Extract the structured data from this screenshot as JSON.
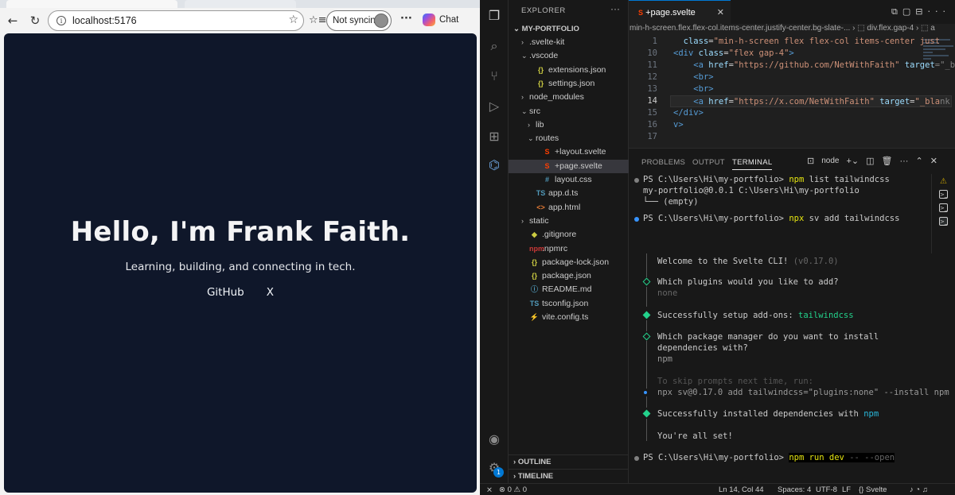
{
  "browser": {
    "address": "localhost:5176",
    "sync_label": "Not syncing",
    "chat_label": "Chat",
    "hero_title": "Hello, I'm Frank Faith.",
    "hero_subtitle": "Learning, building, and connecting in tech.",
    "link_github": "GitHub",
    "link_x": "X"
  },
  "vscode": {
    "explorer_title": "EXPLORER",
    "project": "MY-PORTFOLIO",
    "tree": [
      {
        "label": ".svelte-kit",
        "chev": "›",
        "icon": "",
        "depth": 0
      },
      {
        "label": ".vscode",
        "chev": "⌄",
        "icon": "",
        "depth": 0
      },
      {
        "label": "extensions.json",
        "chev": "",
        "icon": "{}",
        "depth": 1
      },
      {
        "label": "settings.json",
        "chev": "",
        "icon": "{}",
        "depth": 1
      },
      {
        "label": "node_modules",
        "chev": "›",
        "icon": "",
        "depth": 0
      },
      {
        "label": "src",
        "chev": "⌄",
        "icon": "",
        "depth": 0
      },
      {
        "label": "lib",
        "chev": "›",
        "icon": "",
        "depth": 1
      },
      {
        "label": "routes",
        "chev": "⌄",
        "icon": "",
        "depth": 1
      },
      {
        "label": "+layout.svelte",
        "chev": "",
        "icon": "S",
        "depth": 2
      },
      {
        "label": "+page.svelte",
        "chev": "",
        "icon": "S",
        "depth": 2
      },
      {
        "label": "layout.css",
        "chev": "",
        "icon": "#",
        "depth": 2
      },
      {
        "label": "app.d.ts",
        "chev": "",
        "icon": "TS",
        "depth": 1
      },
      {
        "label": "app.html",
        "chev": "",
        "icon": "<>",
        "depth": 1
      },
      {
        "label": "static",
        "chev": "›",
        "icon": "",
        "depth": 0
      },
      {
        "label": ".gitignore",
        "chev": "",
        "icon": "◆",
        "depth": 0
      },
      {
        "label": ".npmrc",
        "chev": "",
        "icon": "npm",
        "depth": 0
      },
      {
        "label": "package-lock.json",
        "chev": "",
        "icon": "{}",
        "depth": 0
      },
      {
        "label": "package.json",
        "chev": "",
        "icon": "{}",
        "depth": 0
      },
      {
        "label": "README.md",
        "chev": "",
        "icon": "ⓘ",
        "depth": 0
      },
      {
        "label": "tsconfig.json",
        "chev": "",
        "icon": "TS",
        "depth": 0
      },
      {
        "label": "vite.config.ts",
        "chev": "",
        "icon": "⚡",
        "depth": 0
      }
    ],
    "outline_label": "OUTLINE",
    "timeline_label": "TIMELINE",
    "settings_badge": "1",
    "editor_tab": "+page.svelte",
    "breadcrumb": "min-h-screen.flex.flex-col.items-center.justify-center.bg-slate-...  ›  ⬚ div.flex.gap-4  ›  ⬚ a",
    "code_lines": [
      {
        "num": "1",
        "parts": [
          [
            "",
            "  "
          ],
          [
            "at",
            "class"
          ],
          [
            "",
            "="
          ],
          [
            "st",
            "\"min-h-screen flex flex-col items-center just"
          ]
        ]
      },
      {
        "num": "10",
        "parts": [
          [
            "tg",
            "<div"
          ],
          [
            "at",
            " class"
          ],
          [
            "",
            "="
          ],
          [
            "st",
            "\"flex gap-4\""
          ],
          [
            "tg",
            ">"
          ]
        ]
      },
      {
        "num": "11",
        "parts": [
          [
            "",
            "    "
          ],
          [
            "tg",
            "<a"
          ],
          [
            "at",
            " href"
          ],
          [
            "",
            "="
          ],
          [
            "st",
            "\"https://github.com/NetWithFaith\""
          ],
          [
            "at",
            " target"
          ],
          [
            "gr",
            "=\"_bla"
          ]
        ]
      },
      {
        "num": "12",
        "parts": [
          [
            "",
            "    "
          ],
          [
            "tg",
            "<br>"
          ]
        ]
      },
      {
        "num": "13",
        "parts": [
          [
            "",
            "    "
          ],
          [
            "tg",
            "<br>"
          ]
        ]
      },
      {
        "num": "14",
        "parts": [
          [
            "",
            "    "
          ],
          [
            "tg",
            "<a"
          ],
          [
            "at",
            " href"
          ],
          [
            "",
            "="
          ],
          [
            "st",
            "\"https://x.com/NetWithFaith\""
          ],
          [
            "at",
            " target"
          ],
          [
            "",
            "="
          ],
          [
            "st",
            "\"_bla"
          ],
          [
            "gr",
            "nk\">X"
          ]
        ]
      },
      {
        "num": "15",
        "parts": [
          [
            "tg",
            "</div>"
          ]
        ]
      },
      {
        "num": "16",
        "parts": [
          [
            "tg",
            "v>"
          ]
        ]
      },
      {
        "num": "17",
        "parts": [
          [
            "",
            ""
          ]
        ]
      }
    ],
    "panel_tabs": [
      "PROBLEMS",
      "OUTPUT",
      "TERMINAL"
    ],
    "terminal_shell": "node",
    "terminal": {
      "l1_prompt": "PS C:\\Users\\Hi\\my-portfolio> ",
      "l1_cmd": "npm",
      "l1_rest": " list tailwindcss",
      "l2": "my-portfolio@0.0.1 C:\\Users\\Hi\\my-portfolio",
      "l3": "└── (empty)",
      "l4_prompt": "PS C:\\Users\\Hi\\my-portfolio> ",
      "l4_cmd": "npx",
      "l4_rest": " sv add tailwindcss",
      "welcome": "Welcome to the Svelte CLI! ",
      "welcome_ver": "(v0.17.0)",
      "q_plugins": "Which plugins would you like to add?",
      "a_plugins": "none",
      "ok_addons": "Successfully setup add-ons: ",
      "ok_addons_val": "tailwindcss",
      "q_pm1": "Which package manager do you want to install",
      "q_pm2": "dependencies with?",
      "a_pm": "npm",
      "skip": "To skip prompts next time, run:",
      "skip_cmd": "npx sv@0.17.0 add tailwindcss=\"plugins:none\" --install npm",
      "ok_deps": "Successfully installed dependencies with ",
      "ok_deps_val": "npm",
      "done": "You're all set!",
      "last_prompt": "PS C:\\Users\\Hi\\my-portfolio> ",
      "last_cmd": "npm run dev",
      "last_rest": " -- --open"
    },
    "status": {
      "errors": "0",
      "warnings": "0",
      "position": "Ln 14, Col 44",
      "spaces": "Spaces: 4",
      "encoding": "UTF-8",
      "eol": "LF",
      "language": "Svelte"
    }
  }
}
